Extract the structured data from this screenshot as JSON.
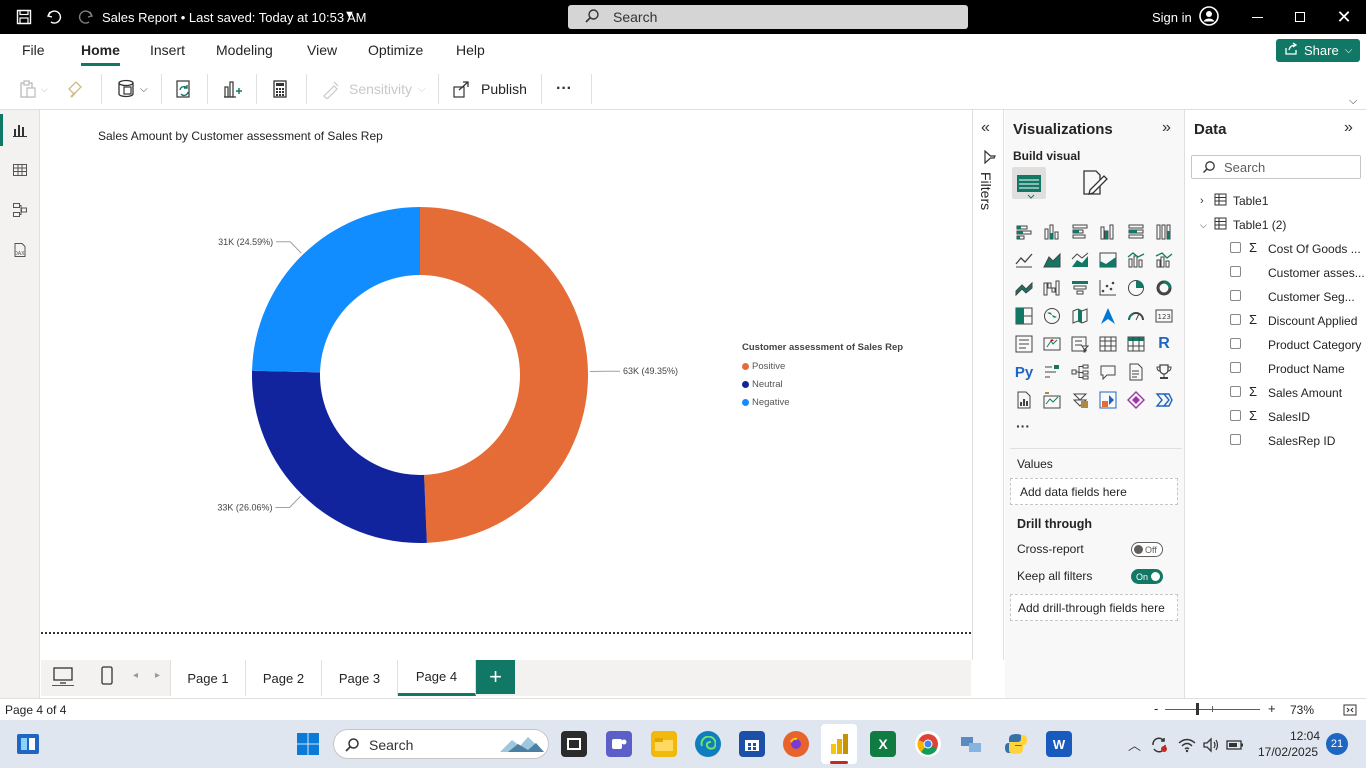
{
  "titlebar": {
    "doc_title": "Sales Report • Last saved: Today at 10:53 AM",
    "search_label": "Search",
    "signin": "Sign in"
  },
  "ribbon": {
    "tabs": [
      "File",
      "Home",
      "Insert",
      "Modeling",
      "View",
      "Optimize",
      "Help"
    ],
    "active_tab": "Home",
    "share": "Share",
    "sensitivity": "Sensitivity",
    "publish": "Publish",
    "more": "···"
  },
  "canvas": {
    "chart_title": "Sales Amount by Customer assessment of Sales Rep"
  },
  "chart_data": {
    "type": "pie",
    "title": "Sales Amount by Customer assessment of Sales Rep",
    "legend_title": "Customer assessment of Sales Rep",
    "legend_position": "right",
    "donut": true,
    "slices": [
      {
        "name": "Positive",
        "value": 63,
        "label": "63K (49.35%)",
        "percent": 49.35,
        "color": "#E66C37"
      },
      {
        "name": "Neutral",
        "value": 33,
        "label": "33K (26.06%)",
        "percent": 26.06,
        "color": "#12239E"
      },
      {
        "name": "Negative",
        "value": 31,
        "label": "31K (24.59%)",
        "percent": 24.59,
        "color": "#118DFF"
      }
    ]
  },
  "filters": {
    "label": "Filters"
  },
  "viz": {
    "title": "Visualizations",
    "build_visual": "Build visual",
    "more": "···",
    "values_label": "Values",
    "values_placeholder": "Add data fields here",
    "drill_through": "Drill through",
    "cross_report": "Cross-report",
    "cross_report_state": "Off",
    "keep_filters": "Keep all filters",
    "keep_filters_state": "On",
    "drill_placeholder": "Add drill-through fields here",
    "r_label": "R",
    "py_label": "Py",
    "num_label": "123"
  },
  "data": {
    "title": "Data",
    "search_placeholder": "Search",
    "tables": [
      "Table1",
      "Table1 (2)"
    ],
    "fields": [
      {
        "name": "Cost Of Goods ...",
        "sigma": true
      },
      {
        "name": "Customer asses...",
        "sigma": false
      },
      {
        "name": "Customer Seg...",
        "sigma": false
      },
      {
        "name": "Discount Applied",
        "sigma": true
      },
      {
        "name": "Product Category",
        "sigma": false
      },
      {
        "name": "Product Name",
        "sigma": false
      },
      {
        "name": "Sales Amount",
        "sigma": true
      },
      {
        "name": "SalesID",
        "sigma": true
      },
      {
        "name": "SalesRep ID",
        "sigma": false
      }
    ]
  },
  "pages": {
    "tabs": [
      "Page 1",
      "Page 2",
      "Page 3",
      "Page 4"
    ],
    "active": "Page 4",
    "add": "+"
  },
  "status": {
    "page_info": "Page 4 of 4",
    "zoom": "73%",
    "zoom_minus": "-",
    "zoom_plus": "+"
  },
  "taskbar": {
    "search": "Search",
    "time": "12:04",
    "date": "17/02/2025",
    "badge": "21"
  },
  "colors": {
    "accent": "#117865",
    "positive": "#E66C37",
    "neutral": "#12239E",
    "negative": "#118DFF"
  }
}
